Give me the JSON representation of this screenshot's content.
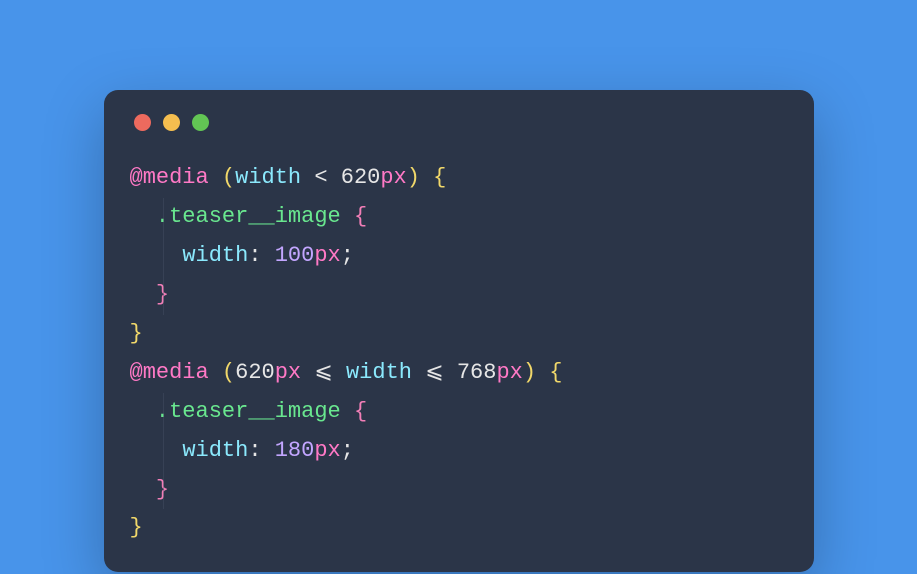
{
  "traffic_lights": {
    "red": "#ed6a5e",
    "yellow": "#f5be4f",
    "green": "#62c554"
  },
  "code": {
    "lines": [
      {
        "indent": 0,
        "tokens": [
          {
            "class": "tk-atrule",
            "text": "@media"
          },
          {
            "class": "tk-text",
            "text": " "
          },
          {
            "class": "tk-punct",
            "text": "("
          },
          {
            "class": "tk-prop",
            "text": "width"
          },
          {
            "class": "tk-text",
            "text": " < 620"
          },
          {
            "class": "tk-atrule",
            "text": "px"
          },
          {
            "class": "tk-punct",
            "text": ")"
          },
          {
            "class": "tk-text",
            "text": " "
          },
          {
            "class": "tk-punct",
            "text": "{"
          }
        ]
      },
      {
        "indent": 1,
        "tokens": [
          {
            "class": "tk-sel",
            "text": ".teaser__image"
          },
          {
            "class": "tk-text",
            "text": " "
          },
          {
            "class": "tk-punct-pink",
            "text": "{"
          }
        ]
      },
      {
        "indent": 2,
        "tokens": [
          {
            "class": "tk-prop",
            "text": "width"
          },
          {
            "class": "tk-text",
            "text": ": "
          },
          {
            "class": "tk-num",
            "text": "100"
          },
          {
            "class": "tk-atrule",
            "text": "px"
          },
          {
            "class": "tk-text",
            "text": ";"
          }
        ]
      },
      {
        "indent": 1,
        "tokens": [
          {
            "class": "tk-punct-pink",
            "text": "}"
          }
        ]
      },
      {
        "indent": 0,
        "tokens": [
          {
            "class": "tk-punct",
            "text": "}"
          }
        ]
      },
      {
        "indent": 0,
        "tokens": [
          {
            "class": "tk-atrule",
            "text": "@media"
          },
          {
            "class": "tk-text",
            "text": " "
          },
          {
            "class": "tk-punct",
            "text": "("
          },
          {
            "class": "tk-text",
            "text": "620"
          },
          {
            "class": "tk-atrule",
            "text": "px"
          },
          {
            "class": "tk-text",
            "text": " ⩽ "
          },
          {
            "class": "tk-prop",
            "text": "width"
          },
          {
            "class": "tk-text",
            "text": " ⩽ 768"
          },
          {
            "class": "tk-atrule",
            "text": "px"
          },
          {
            "class": "tk-punct",
            "text": ")"
          },
          {
            "class": "tk-text",
            "text": " "
          },
          {
            "class": "tk-punct",
            "text": "{"
          }
        ]
      },
      {
        "indent": 1,
        "tokens": [
          {
            "class": "tk-sel",
            "text": ".teaser__image"
          },
          {
            "class": "tk-text",
            "text": " "
          },
          {
            "class": "tk-punct-pink",
            "text": "{"
          }
        ]
      },
      {
        "indent": 2,
        "tokens": [
          {
            "class": "tk-prop",
            "text": "width"
          },
          {
            "class": "tk-text",
            "text": ": "
          },
          {
            "class": "tk-num",
            "text": "180"
          },
          {
            "class": "tk-atrule",
            "text": "px"
          },
          {
            "class": "tk-text",
            "text": ";"
          }
        ]
      },
      {
        "indent": 1,
        "tokens": [
          {
            "class": "tk-punct-pink",
            "text": "}"
          }
        ]
      },
      {
        "indent": 0,
        "tokens": [
          {
            "class": "tk-punct",
            "text": "}"
          }
        ]
      }
    ]
  }
}
